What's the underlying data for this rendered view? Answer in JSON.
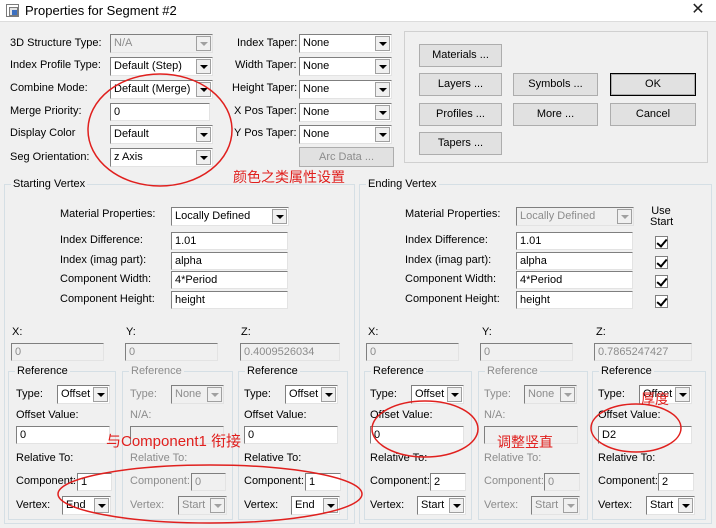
{
  "window": {
    "title": "Properties for Segment #2",
    "close_glyph": "✕"
  },
  "top": {
    "structure_type": {
      "label": "3D Structure Type:",
      "value": "N/A"
    },
    "index_profile_type": {
      "label": "Index Profile Type:",
      "value": "Default (Step)"
    },
    "combine_mode": {
      "label": "Combine Mode:",
      "value": "Default (Merge)"
    },
    "merge_priority": {
      "label": "Merge Priority:",
      "value": "0"
    },
    "display_color": {
      "label": "Display Color",
      "value": "Default"
    },
    "seg_orientation": {
      "label": "Seg Orientation:",
      "value": "z Axis"
    },
    "index_taper": {
      "label": "Index Taper:",
      "value": "None"
    },
    "width_taper": {
      "label": "Width Taper:",
      "value": "None"
    },
    "height_taper": {
      "label": "Height Taper:",
      "value": "None"
    },
    "xpos_taper": {
      "label": "X Pos Taper:",
      "value": "None"
    },
    "ypos_taper": {
      "label": "Y Pos Taper:",
      "value": "None"
    },
    "arc_data": "Arc Data ..."
  },
  "buttons": {
    "materials": "Materials ...",
    "layers": "Layers ...",
    "profiles": "Profiles ...",
    "tapers": "Tapers ...",
    "symbols": "Symbols ...",
    "more": "More ...",
    "ok": "OK",
    "cancel": "Cancel"
  },
  "annotations": {
    "color_props": "颜色之类属性设置",
    "connect_component1": "与Component1 衔接",
    "adjust_vertical": "调整竖直",
    "thickness": "厚度"
  },
  "starting_vertex": {
    "title": "Starting Vertex",
    "material_properties": {
      "label": "Material Properties:",
      "value": "Locally Defined"
    },
    "index_difference": {
      "label": "Index Difference:",
      "value": "1.01"
    },
    "index_imag": {
      "label": "Index (imag part):",
      "value": "alpha"
    },
    "component_width": {
      "label": "Component Width:",
      "value": "4*Period"
    },
    "component_height": {
      "label": "Component Height:",
      "value": "height"
    },
    "x": {
      "label": "X:",
      "value": "0"
    },
    "y": {
      "label": "Y:",
      "value": "0"
    },
    "z": {
      "label": "Z:",
      "value": "0.4009526034"
    },
    "ref_x": {
      "title": "Reference",
      "type_label": "Type:",
      "type": "Offset",
      "offset_label": "Offset Value:",
      "offset": "0",
      "relative_label": "Relative To:",
      "component_label": "Component:",
      "component": "1",
      "vertex_label": "Vertex:",
      "vertex": "End"
    },
    "ref_y": {
      "title": "Reference",
      "type_label": "Type:",
      "type": "None",
      "offset_label": "N/A:",
      "offset": "",
      "relative_label": "Relative To:",
      "component_label": "Component:",
      "component": "0",
      "vertex_label": "Vertex:",
      "vertex": "Start"
    },
    "ref_z": {
      "title": "Reference",
      "type_label": "Type:",
      "type": "Offset",
      "offset_label": "Offset Value:",
      "offset": "0",
      "relative_label": "Relative To:",
      "component_label": "Component:",
      "component": "1",
      "vertex_label": "Vertex:",
      "vertex": "End"
    }
  },
  "ending_vertex": {
    "title": "Ending Vertex",
    "use_start_label": "Use Start",
    "material_properties": {
      "label": "Material Properties:",
      "value": "Locally Defined"
    },
    "index_difference": {
      "label": "Index Difference:",
      "value": "1.01"
    },
    "index_imag": {
      "label": "Index (imag part):",
      "value": "alpha"
    },
    "component_width": {
      "label": "Component Width:",
      "value": "4*Period"
    },
    "component_height": {
      "label": "Component Height:",
      "value": "height"
    },
    "x": {
      "label": "X:",
      "value": "0"
    },
    "y": {
      "label": "Y:",
      "value": "0"
    },
    "z": {
      "label": "Z:",
      "value": "0.7865247427"
    },
    "ref_x": {
      "title": "Reference",
      "type_label": "Type:",
      "type": "Offset",
      "offset_label": "Offset Value:",
      "offset": "0",
      "relative_label": "Relative To:",
      "component_label": "Component:",
      "component": "2",
      "vertex_label": "Vertex:",
      "vertex": "Start"
    },
    "ref_y": {
      "title": "Reference",
      "type_label": "Type:",
      "type": "None",
      "offset_label": "N/A:",
      "offset": "",
      "relative_label": "Relative To:",
      "component_label": "Component:",
      "component": "0",
      "vertex_label": "Vertex:",
      "vertex": "Start"
    },
    "ref_z": {
      "title": "Reference",
      "type_label": "Type:",
      "type": "Offset",
      "offset_label": "Offset Value:",
      "offset": "D2",
      "relative_label": "Relative To:",
      "component_label": "Component:",
      "component": "2",
      "vertex_label": "Vertex:",
      "vertex": "Start"
    }
  },
  "colors": {
    "annotation_red": "#e0201e"
  }
}
